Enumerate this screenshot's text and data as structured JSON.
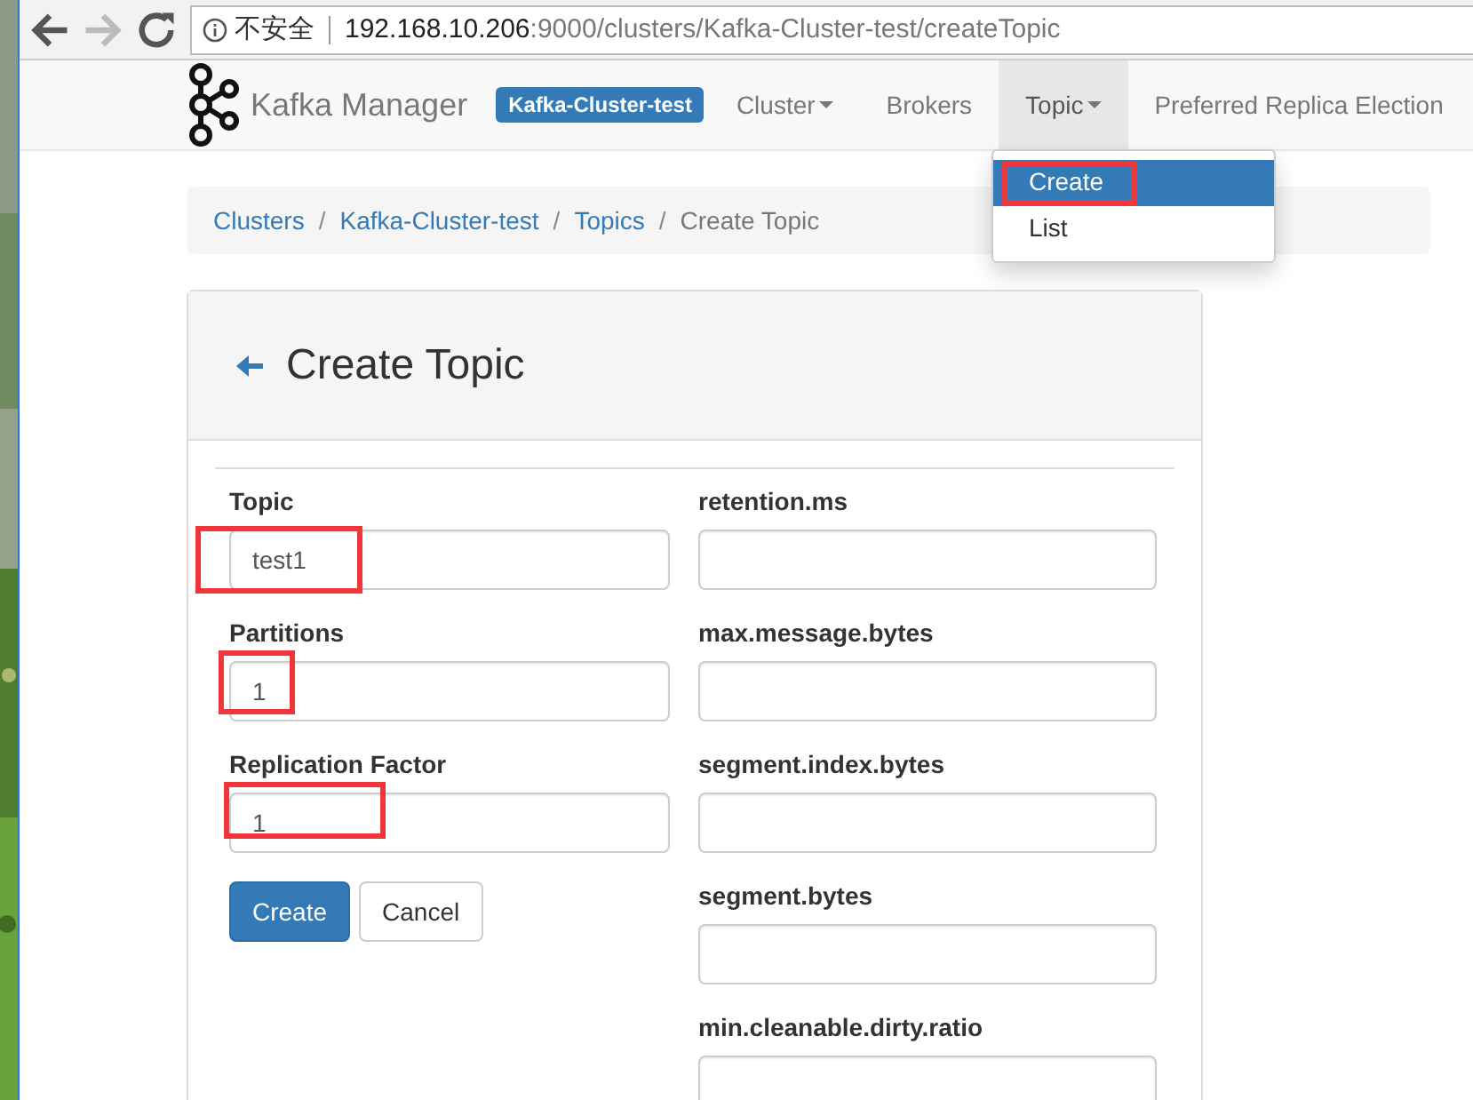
{
  "browser": {
    "security": "不安全",
    "url_host": "192.168.10.206",
    "url_path": ":9000/clusters/Kafka-Cluster-test/createTopic"
  },
  "navbar": {
    "brand": "Kafka Manager",
    "cluster_label": "Kafka-Cluster-test",
    "items": [
      {
        "label": "Cluster",
        "dropdown": true,
        "selected": false
      },
      {
        "label": "Brokers",
        "dropdown": false,
        "selected": false
      },
      {
        "label": "Topic",
        "dropdown": true,
        "selected": true
      },
      {
        "label": "Preferred Replica Election",
        "dropdown": false,
        "selected": false
      }
    ]
  },
  "dropdown_menu": [
    {
      "label": "Create",
      "selected": true,
      "highlighted": true
    },
    {
      "label": "List",
      "selected": false,
      "highlighted": false
    }
  ],
  "breadcrumb": [
    {
      "label": "Clusters",
      "link": true
    },
    {
      "label": "Kafka-Cluster-test",
      "link": true,
      "separator": "/"
    },
    {
      "label": "Topics",
      "link": true,
      "separator": "/"
    },
    {
      "label": "Create Topic",
      "link": false,
      "separator": "/"
    }
  ],
  "panel": {
    "title": "Create Topic"
  },
  "form": {
    "left_fields": [
      {
        "label": "Topic",
        "value": "test1",
        "highlighted": true
      },
      {
        "label": "Partitions",
        "value": "1",
        "highlighted": true
      },
      {
        "label": "Replication Factor",
        "value": "1",
        "highlighted": true
      }
    ],
    "right_fields": [
      {
        "label": "retention.ms"
      },
      {
        "label": "max.message.bytes"
      },
      {
        "label": "segment.index.bytes"
      },
      {
        "label": "segment.bytes"
      },
      {
        "label": "min.cleanable.dirty.ratio"
      }
    ],
    "buttons": [
      {
        "label": "Create",
        "kind": "primary"
      },
      {
        "label": "Cancel",
        "kind": "default"
      }
    ]
  }
}
